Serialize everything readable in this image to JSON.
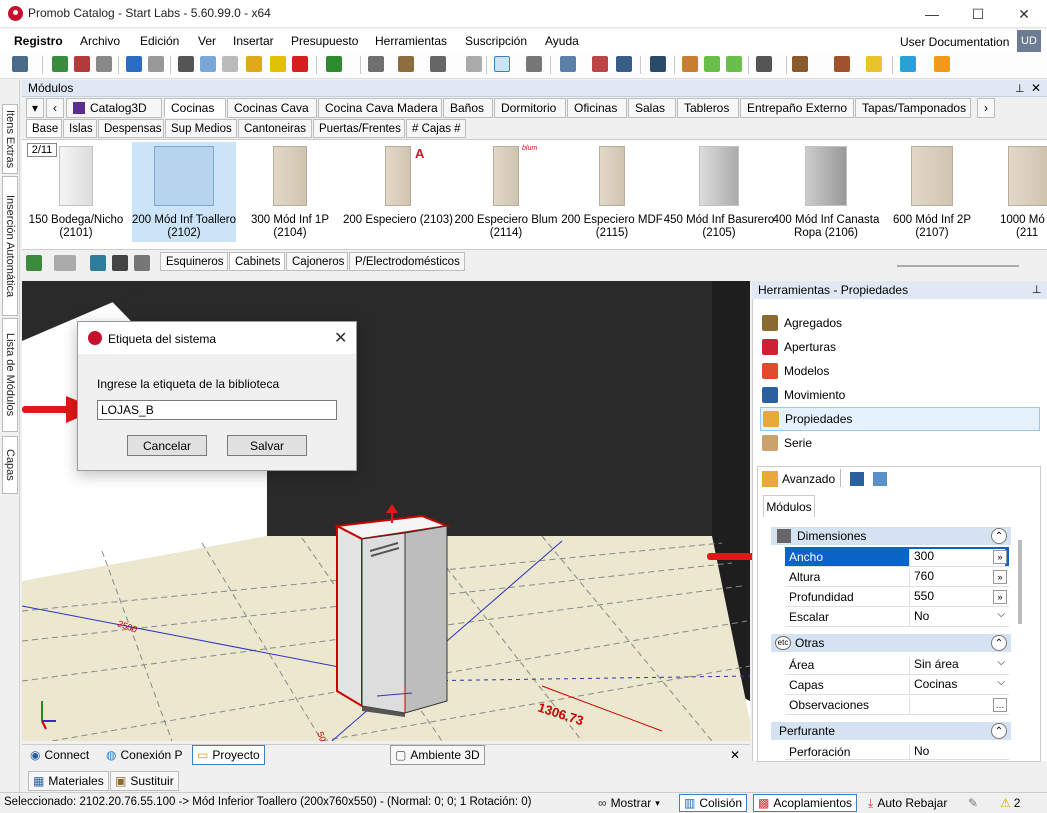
{
  "window": {
    "title": "Promob Catalog - Start Labs - 5.60.99.0 - x64",
    "minimize": "—",
    "maximize": "☐",
    "close": "✕"
  },
  "menu": {
    "items": [
      "Registro",
      "Archivo",
      "Edición",
      "Ver",
      "Insertar",
      "Presupuesto",
      "Herramientas",
      "Suscripción",
      "Ayuda"
    ],
    "user_doc": "User Documentation",
    "user_initials": "UD"
  },
  "sidebar": {
    "tabs": [
      "Itens Extras",
      "Inserción Automática",
      "Lista de Módulos",
      "Capas"
    ]
  },
  "modules_panel": {
    "title": "Módulos",
    "pin": "📌",
    "close": "✕",
    "tabs_level1": [
      "Catalog3D",
      "Cocinas",
      "Cocinas Cava",
      "Cocina Cava Madera",
      "Baños",
      "Dormitorio",
      "Oficinas",
      "Salas",
      "Tableros",
      "Entrepaño Externo",
      "Tapas/Tamponados"
    ],
    "active_tab1": "Cocinas",
    "tabs_level2": [
      "Base",
      "Islas",
      "Despensas",
      "Sup Medios",
      "Cantoneiras",
      "Puertas/Frentes",
      "# Cajas #"
    ],
    "active_tab2": "Base",
    "page_indicator": "2/11",
    "items": [
      {
        "name": "150 Bodega/Nicho",
        "code": "(2101)"
      },
      {
        "name": "200 Mód Inf Toallero",
        "code": "(2102)"
      },
      {
        "name": "300 Mód Inf 1P",
        "code": "(2104)"
      },
      {
        "name": "200 Especiero (2103)",
        "code": ""
      },
      {
        "name": "200 Especiero Blum",
        "code": "(2114)"
      },
      {
        "name": "200 Especiero MDF",
        "code": "(2115)"
      },
      {
        "name": "450 Mód Inf Basurero",
        "code": "(2105)"
      },
      {
        "name": "400 Mód Inf Canasta",
        "code": "Ropa (2106)"
      },
      {
        "name": "600 Mód Inf 2P",
        "code": "(2107)"
      },
      {
        "name": "1000 Mó",
        "code": "(211"
      }
    ],
    "badge_letter": "A",
    "blum_label": "blum"
  },
  "subtoolbar": {
    "tabs": [
      "Esquineros",
      "Cabinets",
      "Cajoneros",
      "P/Electrodomésticos"
    ],
    "active": "Cabinets"
  },
  "dialog": {
    "title": "Etiqueta del sistema",
    "prompt": "Ingrese la etiqueta de la biblioteca",
    "input_value": "LOJAS_B",
    "cancel": "Cancelar",
    "save": "Salvar"
  },
  "viewport": {
    "dimension_label": "1306.73",
    "dim_small": "2500",
    "dim_small2": "50"
  },
  "bottom_tabs": {
    "items": [
      "Connect",
      "Conexión P",
      "Proyecto",
      "Ambiente 3D"
    ],
    "close": "✕",
    "lower": [
      "Materiales",
      "Sustituir"
    ]
  },
  "right_panel": {
    "title": "Herramientas - Propiedades",
    "tools": [
      "Agregados",
      "Aperturas",
      "Modelos",
      "Movimiento",
      "Propiedades",
      "Serie"
    ],
    "selected_tool": "Propiedades",
    "advanced": "Avanzado",
    "modules_tab": "Módulos",
    "sections": {
      "dimensiones": "Dimensiones",
      "otras": "Otras",
      "perfurante": "Perfurante"
    },
    "props_dim": [
      {
        "name": "Ancho",
        "value": "300"
      },
      {
        "name": "Altura",
        "value": "760"
      },
      {
        "name": "Profundidad",
        "value": "550"
      },
      {
        "name": "Escalar",
        "value": "No"
      }
    ],
    "props_otras": [
      {
        "name": "Área",
        "value": "Sin área"
      },
      {
        "name": "Capas",
        "value": "Cocinas"
      },
      {
        "name": "Observaciones",
        "value": ""
      }
    ],
    "props_perf": [
      {
        "name": "Perforación",
        "value": "No"
      }
    ]
  },
  "status": {
    "selected": "Seleccionado: 2102.20.76.55.100 -> Mód Inferior Toallero  (200x760x550) - (Normal: 0; 0; 1 Rotación: 0)",
    "show": "Mostrar",
    "collision": "Colisión",
    "couplings": "Acoplamientos",
    "auto_lower": "Auto Rebajar",
    "warnings": "2"
  }
}
